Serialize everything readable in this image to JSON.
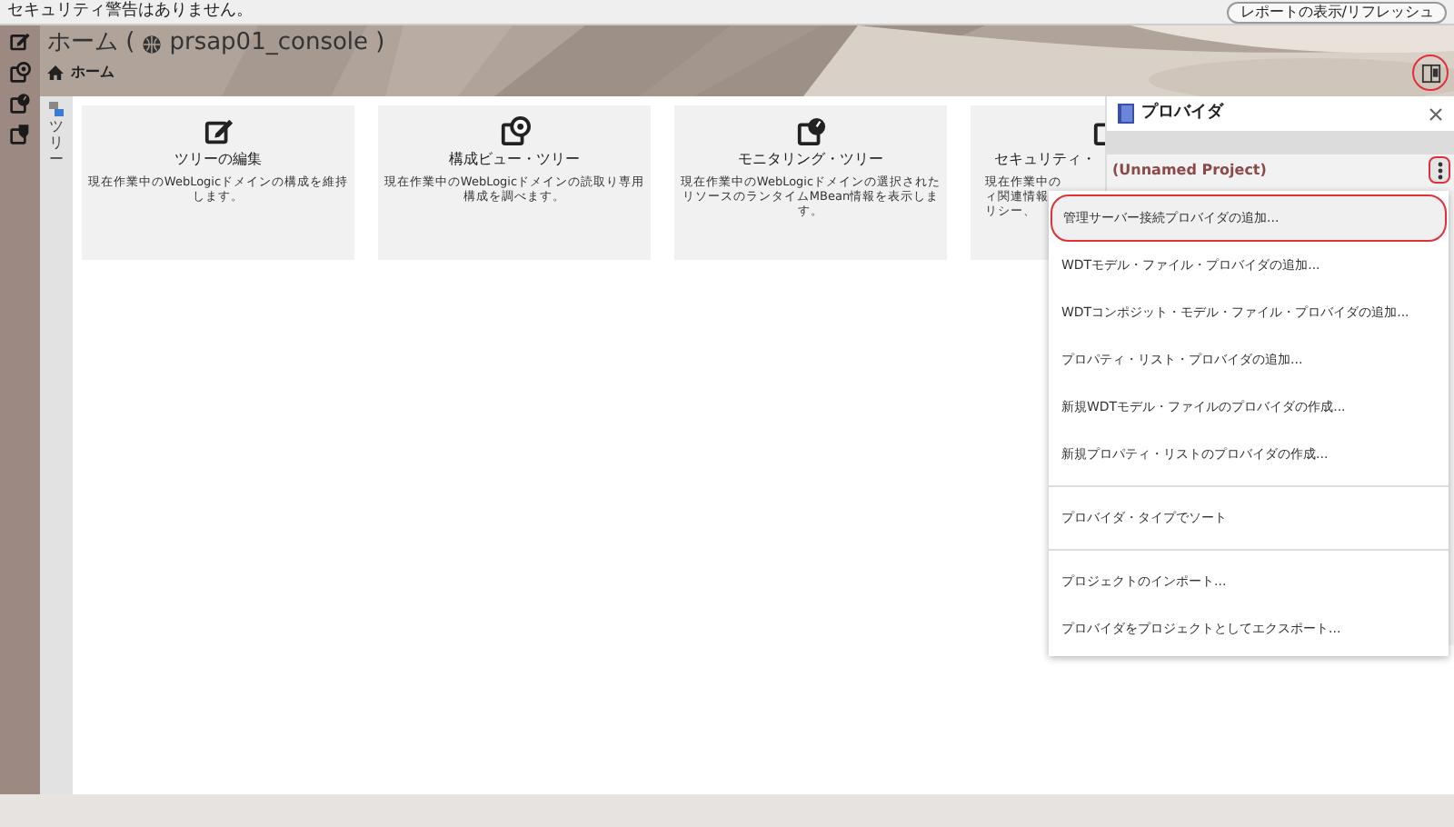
{
  "status_bar": {
    "message": "セキュリティ警告はありません。",
    "button": "レポートの表示/リフレッシュ"
  },
  "header": {
    "title_prefix": "ホーム (",
    "domain": "prsap01_console )",
    "breadcrumb": "ホーム",
    "panel_toggle_highlighted": true
  },
  "side_tab": {
    "label": "ツリー"
  },
  "cards": [
    {
      "title": "ツリーの編集",
      "lines": [
        "現在作業中のWebLogicドメインの構成を維持",
        "します。"
      ]
    },
    {
      "title": "構成ビュー・ツリー",
      "lines": [
        "現在作業中のWebLogicドメインの読取り専用",
        "構成を調べます。"
      ]
    },
    {
      "title": "モニタリング・ツリー",
      "lines": [
        "現在作業中のWebLogicドメインの選択された",
        "リソースのランタイムMBean情報を表示しま",
        "す。"
      ]
    },
    {
      "title": "セキュリティ・",
      "lines": [
        "現在作業中の",
        "ィ関連情報",
        "リシー、"
      ]
    }
  ],
  "provider_panel": {
    "title": "プロバイダ",
    "project": "(Unnamed Project)",
    "menu_button_highlighted": true
  },
  "menu": [
    {
      "label": "管理サーバー接続プロバイダの追加...",
      "highlighted": true,
      "divider_before": false
    },
    {
      "label": "WDTモデル・ファイル・プロバイダの追加...",
      "highlighted": false,
      "divider_before": false
    },
    {
      "label": "WDTコンポジット・モデル・ファイル・プロバイダの追加...",
      "highlighted": false,
      "divider_before": false
    },
    {
      "label": "プロパティ・リスト・プロバイダの追加...",
      "highlighted": false,
      "divider_before": false
    },
    {
      "label": "新規WDTモデル・ファイルのプロバイダの作成...",
      "highlighted": false,
      "divider_before": false
    },
    {
      "label": "新規プロパティ・リストのプロバイダの作成...",
      "highlighted": false,
      "divider_before": false
    },
    {
      "label": "プロバイダ・タイプでソート",
      "highlighted": false,
      "divider_before": true
    },
    {
      "label": "プロジェクトのインポート...",
      "highlighted": false,
      "divider_before": true
    },
    {
      "label": "プロバイダをプロジェクトとしてエクスポート...",
      "highlighted": false,
      "divider_before": false
    }
  ]
}
